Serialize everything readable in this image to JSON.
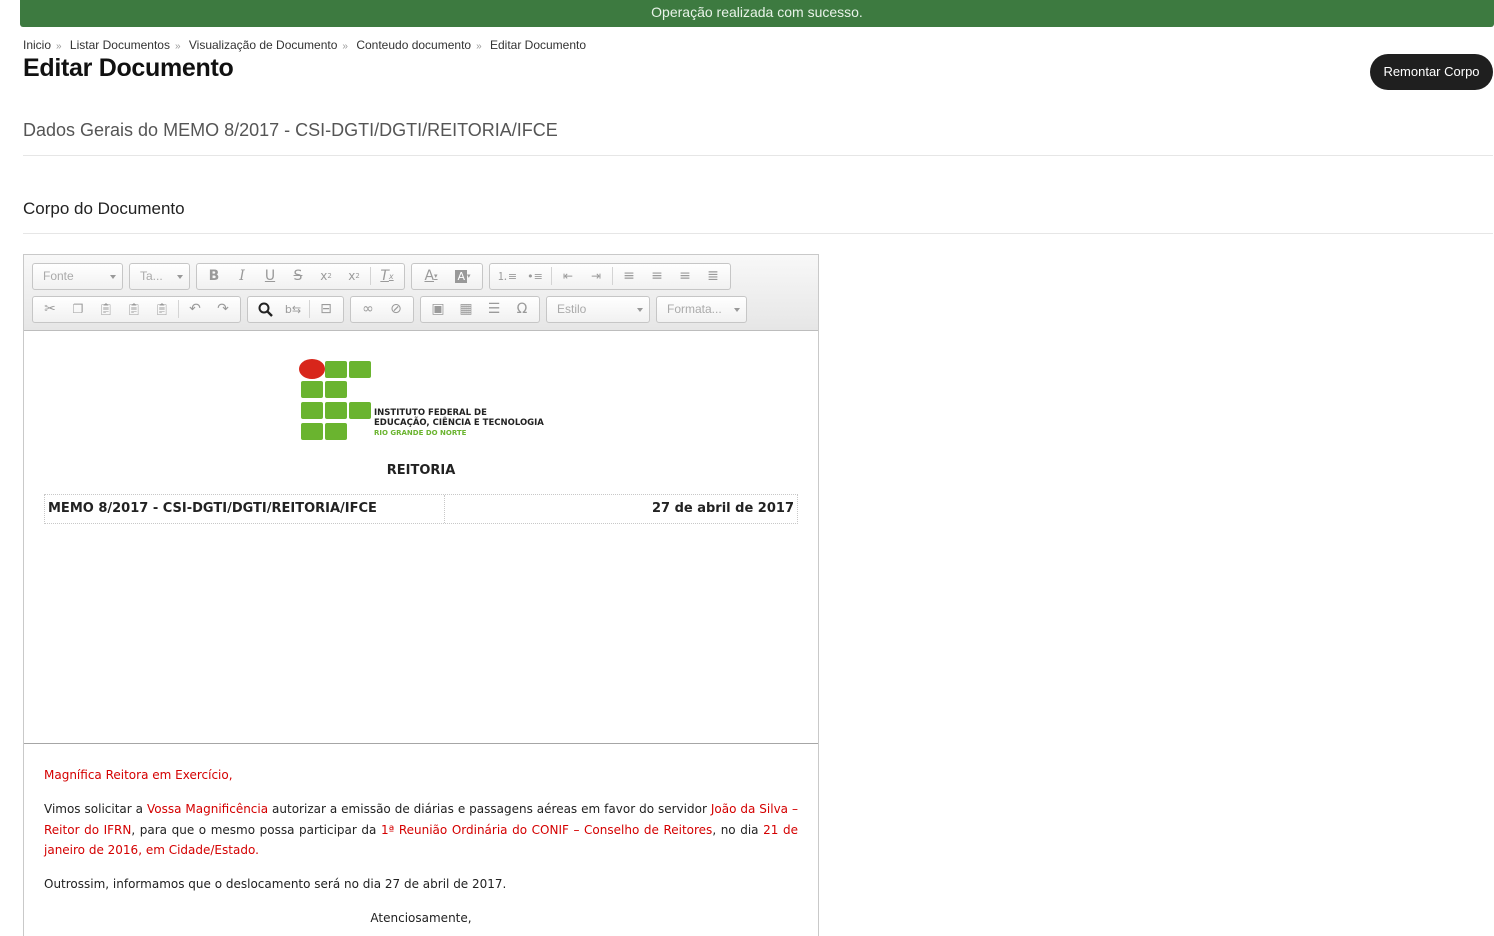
{
  "alert": {
    "message": "Operação realizada com sucesso."
  },
  "breadcrumb": [
    "Inicio",
    "Listar Documentos",
    "Visualização de Documento",
    "Conteudo documento",
    "Editar Documento"
  ],
  "header": {
    "title": "Editar Documento",
    "remontar_label": "Remontar Corpo"
  },
  "sections": {
    "dados_gerais": "Dados Gerais do MEMO 8/2017 - CSI-DGTI/DGTI/REITORIA/IFCE",
    "corpo": "Corpo do Documento"
  },
  "editor": {
    "toolbar": {
      "font_placeholder": "Fonte",
      "size_placeholder": "Ta...",
      "style_placeholder": "Estilo",
      "format_placeholder": "Formata..."
    },
    "header_block": {
      "logo_line1": "INSTITUTO FEDERAL DE",
      "logo_line2": "EDUCAÇÃO, CIÊNCIA E TECNOLOGIA",
      "logo_line3": "RIO GRANDE DO NORTE",
      "unit": "REITORIA",
      "memo_id": "MEMO 8/2017 - CSI-DGTI/DGTI/REITORIA/IFCE",
      "date": "27 de abril de 2017"
    },
    "body": {
      "salutation": "Magnífica Reitora em Exercício,",
      "p2_a": "Vimos solicitar a ",
      "p2_b": "Vossa Magnificência",
      "p2_c": " autorizar a emissão de diárias e passagens aéreas em favor do servidor ",
      "p2_d": "João da Silva – Reitor do IFRN",
      "p2_e": ", para que o mesmo possa participar da ",
      "p2_f": "1ª Reunião Ordinária do CONIF – Conselho de Reitores",
      "p2_g": ", no dia ",
      "p2_h": "21 de janeiro de 2016, em Cidade/Estado.",
      "p3": "Outrossim, informamos que o deslocamento será no dia 27 de abril de 2017.",
      "closing": "Atenciosamente,"
    }
  },
  "colors": {
    "success": "#3d7a40",
    "highlight_red": "#d40000",
    "logo_green": "#6ab42f",
    "logo_red": "#d8261b"
  }
}
